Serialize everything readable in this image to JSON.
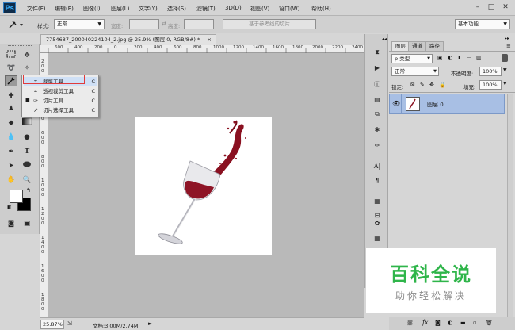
{
  "app": {
    "logo": "Ps"
  },
  "menu": [
    "文件(F)",
    "编辑(E)",
    "图像(I)",
    "图层(L)",
    "文字(Y)",
    "选择(S)",
    "滤镜(T)",
    "3D(D)",
    "视图(V)",
    "窗口(W)",
    "帮助(H)"
  ],
  "window_controls": [
    "–",
    "□",
    "✕"
  ],
  "options": {
    "style_label": "样式:",
    "style_value": "正常",
    "width_label": "宽度:",
    "height_label": "高度:",
    "slice_button": "基于参考线的切片",
    "workspace": "基本功能"
  },
  "document": {
    "tab_title": "7754687_200040224104_2.jpg @ 25.9% (图层 0, RGB/8#) *",
    "close": "×",
    "ruler_top": [
      "600",
      "400",
      "200",
      "0",
      "200",
      "400",
      "600",
      "800",
      "1000",
      "1200",
      "1400",
      "1600",
      "1800",
      "2000",
      "2200",
      "2400"
    ],
    "ruler_left": [
      "2",
      "0",
      "0",
      "2",
      "0",
      "0",
      "4",
      "0",
      "0",
      "6",
      "0",
      "0",
      "8",
      "0",
      "0",
      "1",
      "0",
      "0",
      "0",
      "1",
      "2",
      "0",
      "0",
      "1",
      "4",
      "0",
      "0",
      "1",
      "6",
      "0",
      "0",
      "1",
      "8",
      "0",
      "0"
    ],
    "zoom": "25.87%",
    "doc_info": "文档:3.00M/2.74M"
  },
  "flyout": {
    "items": [
      {
        "label": "裁剪工具",
        "shortcut": "C",
        "icon": "crop-icon",
        "selected": true
      },
      {
        "label": "透视裁剪工具",
        "shortcut": "C",
        "icon": "perspective-crop-icon",
        "selected": false
      },
      {
        "label": "切片工具",
        "shortcut": "C",
        "icon": "slice-icon",
        "selected": false
      },
      {
        "label": "切片选择工具",
        "shortcut": "C",
        "icon": "slice-select-icon",
        "selected": false
      }
    ]
  },
  "layers": {
    "tabs": [
      "图层",
      "通道",
      "路径"
    ],
    "kind_filter": "ρ 类型",
    "blend_mode": "正常",
    "opacity_label": "不透明度:",
    "opacity_value": "100%",
    "lock_label": "锁定:",
    "fill_label": "填充:",
    "fill_value": "100%",
    "layer_name": "图层 0"
  },
  "watermark": {
    "title": "百科全说",
    "subtitle": "助你轻松解决"
  },
  "colors": {
    "selection_row": "#a8bfe4",
    "watermark_green": "#2fb54a",
    "flyout_highlight": "#e13b3b"
  }
}
